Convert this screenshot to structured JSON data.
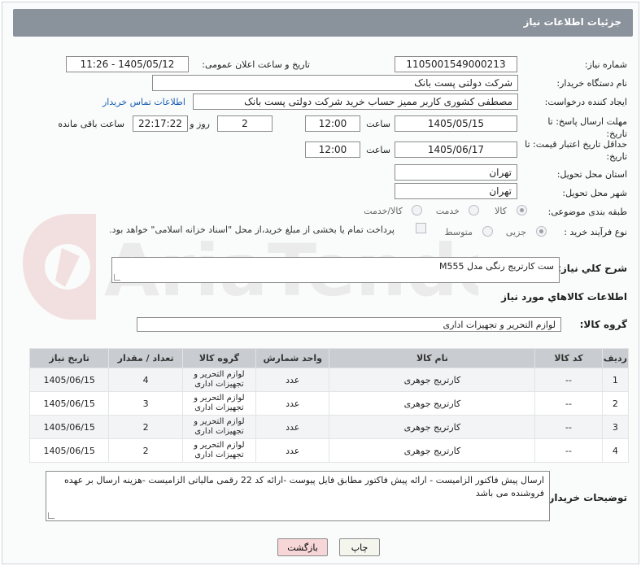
{
  "header": {
    "title": "جزئیات اطلاعات نیاز"
  },
  "fields": {
    "need_number_label": "شماره نیاز:",
    "need_number": "1105001549000213",
    "announce_label": "تاریخ و ساعت اعلان عمومی:",
    "announce_value": "1405/05/12 - 11:26",
    "buyer_org_label": "نام دستگاه خریدار:",
    "buyer_org": "شرکت دولتی پست بانک",
    "creator_label": "ایجاد کننده درخواست:",
    "creator": "مصطفی کشوری کاربر ممیز حساب خرید شرکت دولتی پست بانک",
    "contact_link": "اطلاعات تماس خریدار",
    "reply_deadline_label": "مهلت ارسال پاسخ: تا تاریخ:",
    "reply_date": "1405/05/15",
    "time_label": "ساعت",
    "reply_time": "12:00",
    "days_value": "2",
    "days_label": "روز و",
    "remaining_time": "22:17:22",
    "remaining_label": "ساعت باقی مانده",
    "price_validity_label": "حداقل تاریخ اعتبار قیمت: تا تاریخ:",
    "price_date": "1405/06/17",
    "price_time": "12:00",
    "province_label": "استان محل تحویل:",
    "province": "تهران",
    "city_label": "شهر محل تحویل:",
    "city": "تهران",
    "category_label": "طبقه بندی موضوعی:",
    "category_options": [
      "کالا",
      "خدمت",
      "کالا/خدمت"
    ],
    "purchase_type_label": "نوع فرآیند خرید :",
    "purchase_options": [
      "جزیی",
      "متوسط"
    ],
    "payment_note": "پرداخت تمام یا بخشی از مبلغ خرید،از محل \"اسناد خزانه اسلامی\" خواهد بود."
  },
  "description": {
    "label": "شرح کلي نياز:",
    "value": "ست کارتریج رنگی مدل M555"
  },
  "goods": {
    "section_title": "اطلاعات کالاهاي مورد نياز",
    "group_label": "گروه کالا:",
    "group_value": "لوازم التحرير و تجهيزات اداری",
    "columns": [
      "رديف",
      "کد کالا",
      "نام کالا",
      "واحد شمارش",
      "گروه کالا",
      "تعداد / مقدار",
      "تاریخ نیاز"
    ],
    "rows": [
      {
        "idx": "1",
        "code": "--",
        "name": "کارتریج جوهری",
        "unit": "عدد",
        "group": "لوازم التحرير و تجهيزات اداری",
        "qty": "4",
        "date": "1405/06/15"
      },
      {
        "idx": "2",
        "code": "--",
        "name": "کارتریج جوهری",
        "unit": "عدد",
        "group": "لوازم التحرير و تجهيزات اداری",
        "qty": "3",
        "date": "1405/06/15"
      },
      {
        "idx": "3",
        "code": "--",
        "name": "کارتریج جوهری",
        "unit": "عدد",
        "group": "لوازم التحرير و تجهيزات اداری",
        "qty": "2",
        "date": "1405/06/15"
      },
      {
        "idx": "4",
        "code": "--",
        "name": "کارتریج جوهری",
        "unit": "عدد",
        "group": "لوازم التحرير و تجهيزات اداری",
        "qty": "2",
        "date": "1405/06/15"
      }
    ]
  },
  "buyer_notes": {
    "label": "توضیحات خریدار:",
    "value": "ارسال پیش فاکتور الزامیست - ارائه پیش فاکتور مطابق فایل پیوست -ارائه کد 22 رقمی مالیاتی الزامیست -هزینه ارسال بر عهده فروشنده می باشد"
  },
  "buttons": {
    "print": "چاپ",
    "back": "بازگشت"
  },
  "watermark_text": "AriaTender.net",
  "colors": {
    "header_bg": "#8a929b",
    "link": "#1a5fb4",
    "back_btn": "#f6d6d6"
  }
}
